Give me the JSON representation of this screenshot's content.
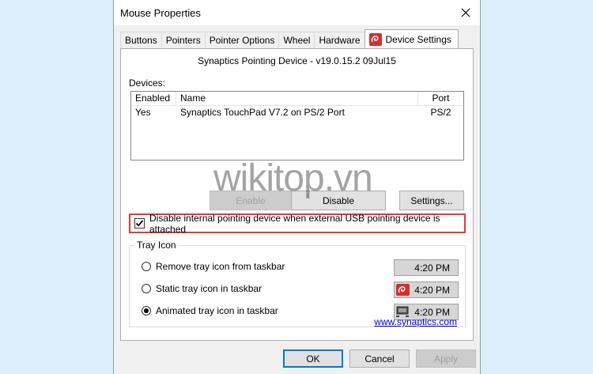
{
  "window": {
    "title": "Mouse Properties"
  },
  "tabs": [
    {
      "label": "Buttons"
    },
    {
      "label": "Pointers"
    },
    {
      "label": "Pointer Options"
    },
    {
      "label": "Wheel"
    },
    {
      "label": "Hardware"
    },
    {
      "label": "Device Settings",
      "icon": "synaptics-icon",
      "active": true
    }
  ],
  "device_settings": {
    "version": "Synaptics Pointing Device - v19.0.15.2 09Jul15",
    "devices_label": "Devices:",
    "columns": [
      "Enabled",
      "Name",
      "Port"
    ],
    "rows": [
      {
        "enabled": "Yes",
        "name": "Synaptics TouchPad V7.2 on PS/2 Port",
        "port": "PS/2"
      }
    ],
    "enable_label": "Enable",
    "disable_label": "Disable",
    "settings_label": "Settings...",
    "checkbox_label": "Disable internal pointing device when external USB pointing device is attached",
    "checkbox_checked": true
  },
  "tray": {
    "legend": "Tray Icon",
    "options": [
      {
        "label": "Remove tray icon from taskbar",
        "selected": false,
        "time": "4:20 PM",
        "icon": "none"
      },
      {
        "label": "Static tray icon in taskbar",
        "selected": false,
        "time": "4:20 PM",
        "icon": "synaptics-icon"
      },
      {
        "label": "Animated tray icon in taskbar",
        "selected": true,
        "time": "4:20 PM",
        "icon": "monitor-icon"
      }
    ]
  },
  "link": "www.synaptics.com",
  "footer": {
    "ok_label": "OK",
    "cancel_label": "Cancel",
    "apply_label": "Apply"
  },
  "watermark": "wikitop.vn",
  "colors": {
    "highlight_border": "#e53935",
    "synaptics_red": "#d32f2f",
    "link": "#0000ee",
    "default_button_border": "#0078d7"
  }
}
